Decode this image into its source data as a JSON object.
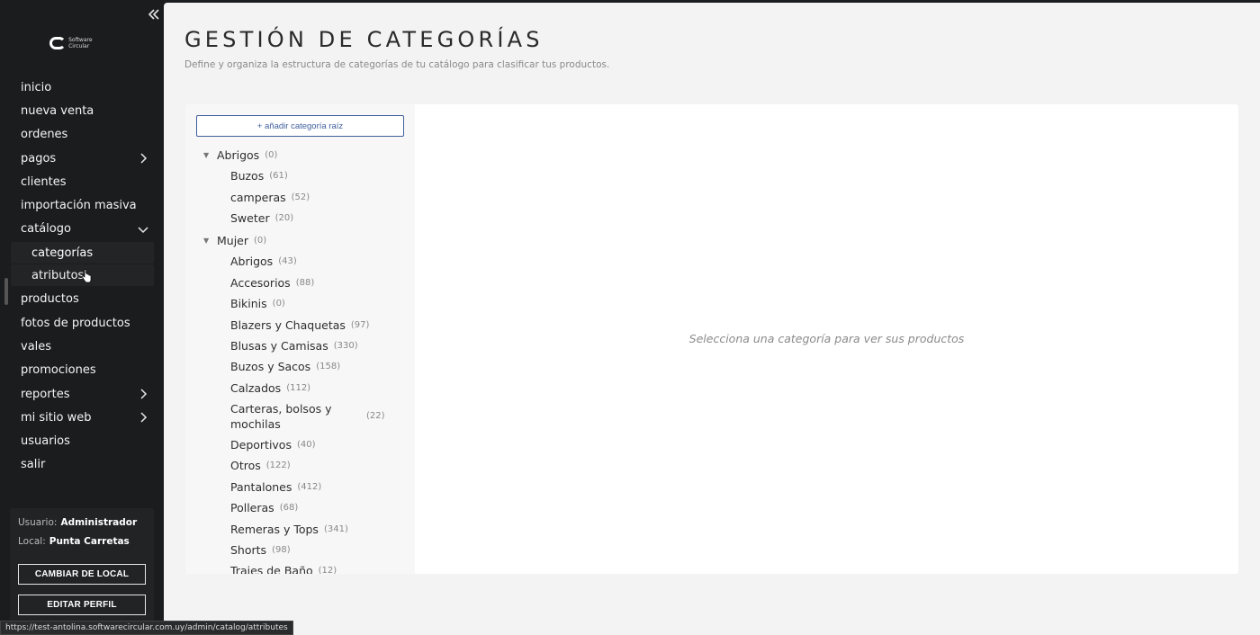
{
  "sidebar": {
    "logo_text": "Software Circular",
    "nav": [
      {
        "label": "inicio"
      },
      {
        "label": "nueva venta"
      },
      {
        "label": "ordenes"
      },
      {
        "label": "pagos"
      },
      {
        "label": "clientes"
      },
      {
        "label": "importación masiva"
      },
      {
        "label": "catálogo"
      },
      {
        "label": "categorías"
      },
      {
        "label": "atributos"
      },
      {
        "label": "productos"
      },
      {
        "label": "fotos de productos"
      },
      {
        "label": "vales"
      },
      {
        "label": "promociones"
      },
      {
        "label": "reportes"
      },
      {
        "label": "mi sitio web"
      },
      {
        "label": "usuarios"
      },
      {
        "label": "salir"
      }
    ],
    "user_label": "Usuario:",
    "user_value": "Administrador",
    "local_label": "Local:",
    "local_value": "Punta Carretas",
    "change_local_button": "CAMBIAR DE LOCAL",
    "edit_profile_button": "EDITAR PERFIL"
  },
  "main": {
    "title": "GESTIÓN DE CATEGORÍAS",
    "subtitle": "Define y organiza la estructura de categorías de tu catálogo para clasificar tus productos.",
    "add_root_button": "+ añadir categoría raíz",
    "tree": [
      {
        "name": "Abrigos",
        "count": "(0)",
        "children": [
          {
            "name": "Buzos",
            "count": "(61)"
          },
          {
            "name": "camperas",
            "count": "(52)"
          },
          {
            "name": "Sweter",
            "count": "(20)"
          }
        ]
      },
      {
        "name": "Mujer",
        "count": "(0)",
        "children": [
          {
            "name": "Abrigos",
            "count": "(43)"
          },
          {
            "name": "Accesorios",
            "count": "(88)"
          },
          {
            "name": "Bikinis",
            "count": "(0)"
          },
          {
            "name": "Blazers y Chaquetas",
            "count": "(97)"
          },
          {
            "name": "Blusas y Camisas",
            "count": "(330)"
          },
          {
            "name": "Buzos y Sacos",
            "count": "(158)"
          },
          {
            "name": "Calzados",
            "count": "(112)"
          },
          {
            "name": "Carteras, bolsos y mochilas",
            "count": "(22)"
          },
          {
            "name": "Deportivos",
            "count": "(40)"
          },
          {
            "name": "Otros",
            "count": "(122)"
          },
          {
            "name": "Pantalones",
            "count": "(412)"
          },
          {
            "name": "Polleras",
            "count": "(68)"
          },
          {
            "name": "Remeras y Tops",
            "count": "(341)"
          },
          {
            "name": "Shorts",
            "count": "(98)"
          },
          {
            "name": "Trajes de Baño",
            "count": "(12)"
          }
        ]
      }
    ],
    "placeholder": "Selecciona una categoría para ver sus productos"
  },
  "status_bar": {
    "url": "https://test-antolina.softwarecircular.com.uy/admin/catalog/attributes"
  },
  "icons": {
    "collapse": "double-chevron-left-icon",
    "chevron_right": "chevron-right-icon",
    "chevron_down": "chevron-down-icon",
    "tree_toggle": "triangle-down-icon",
    "cursor": "hand-pointer-icon"
  }
}
